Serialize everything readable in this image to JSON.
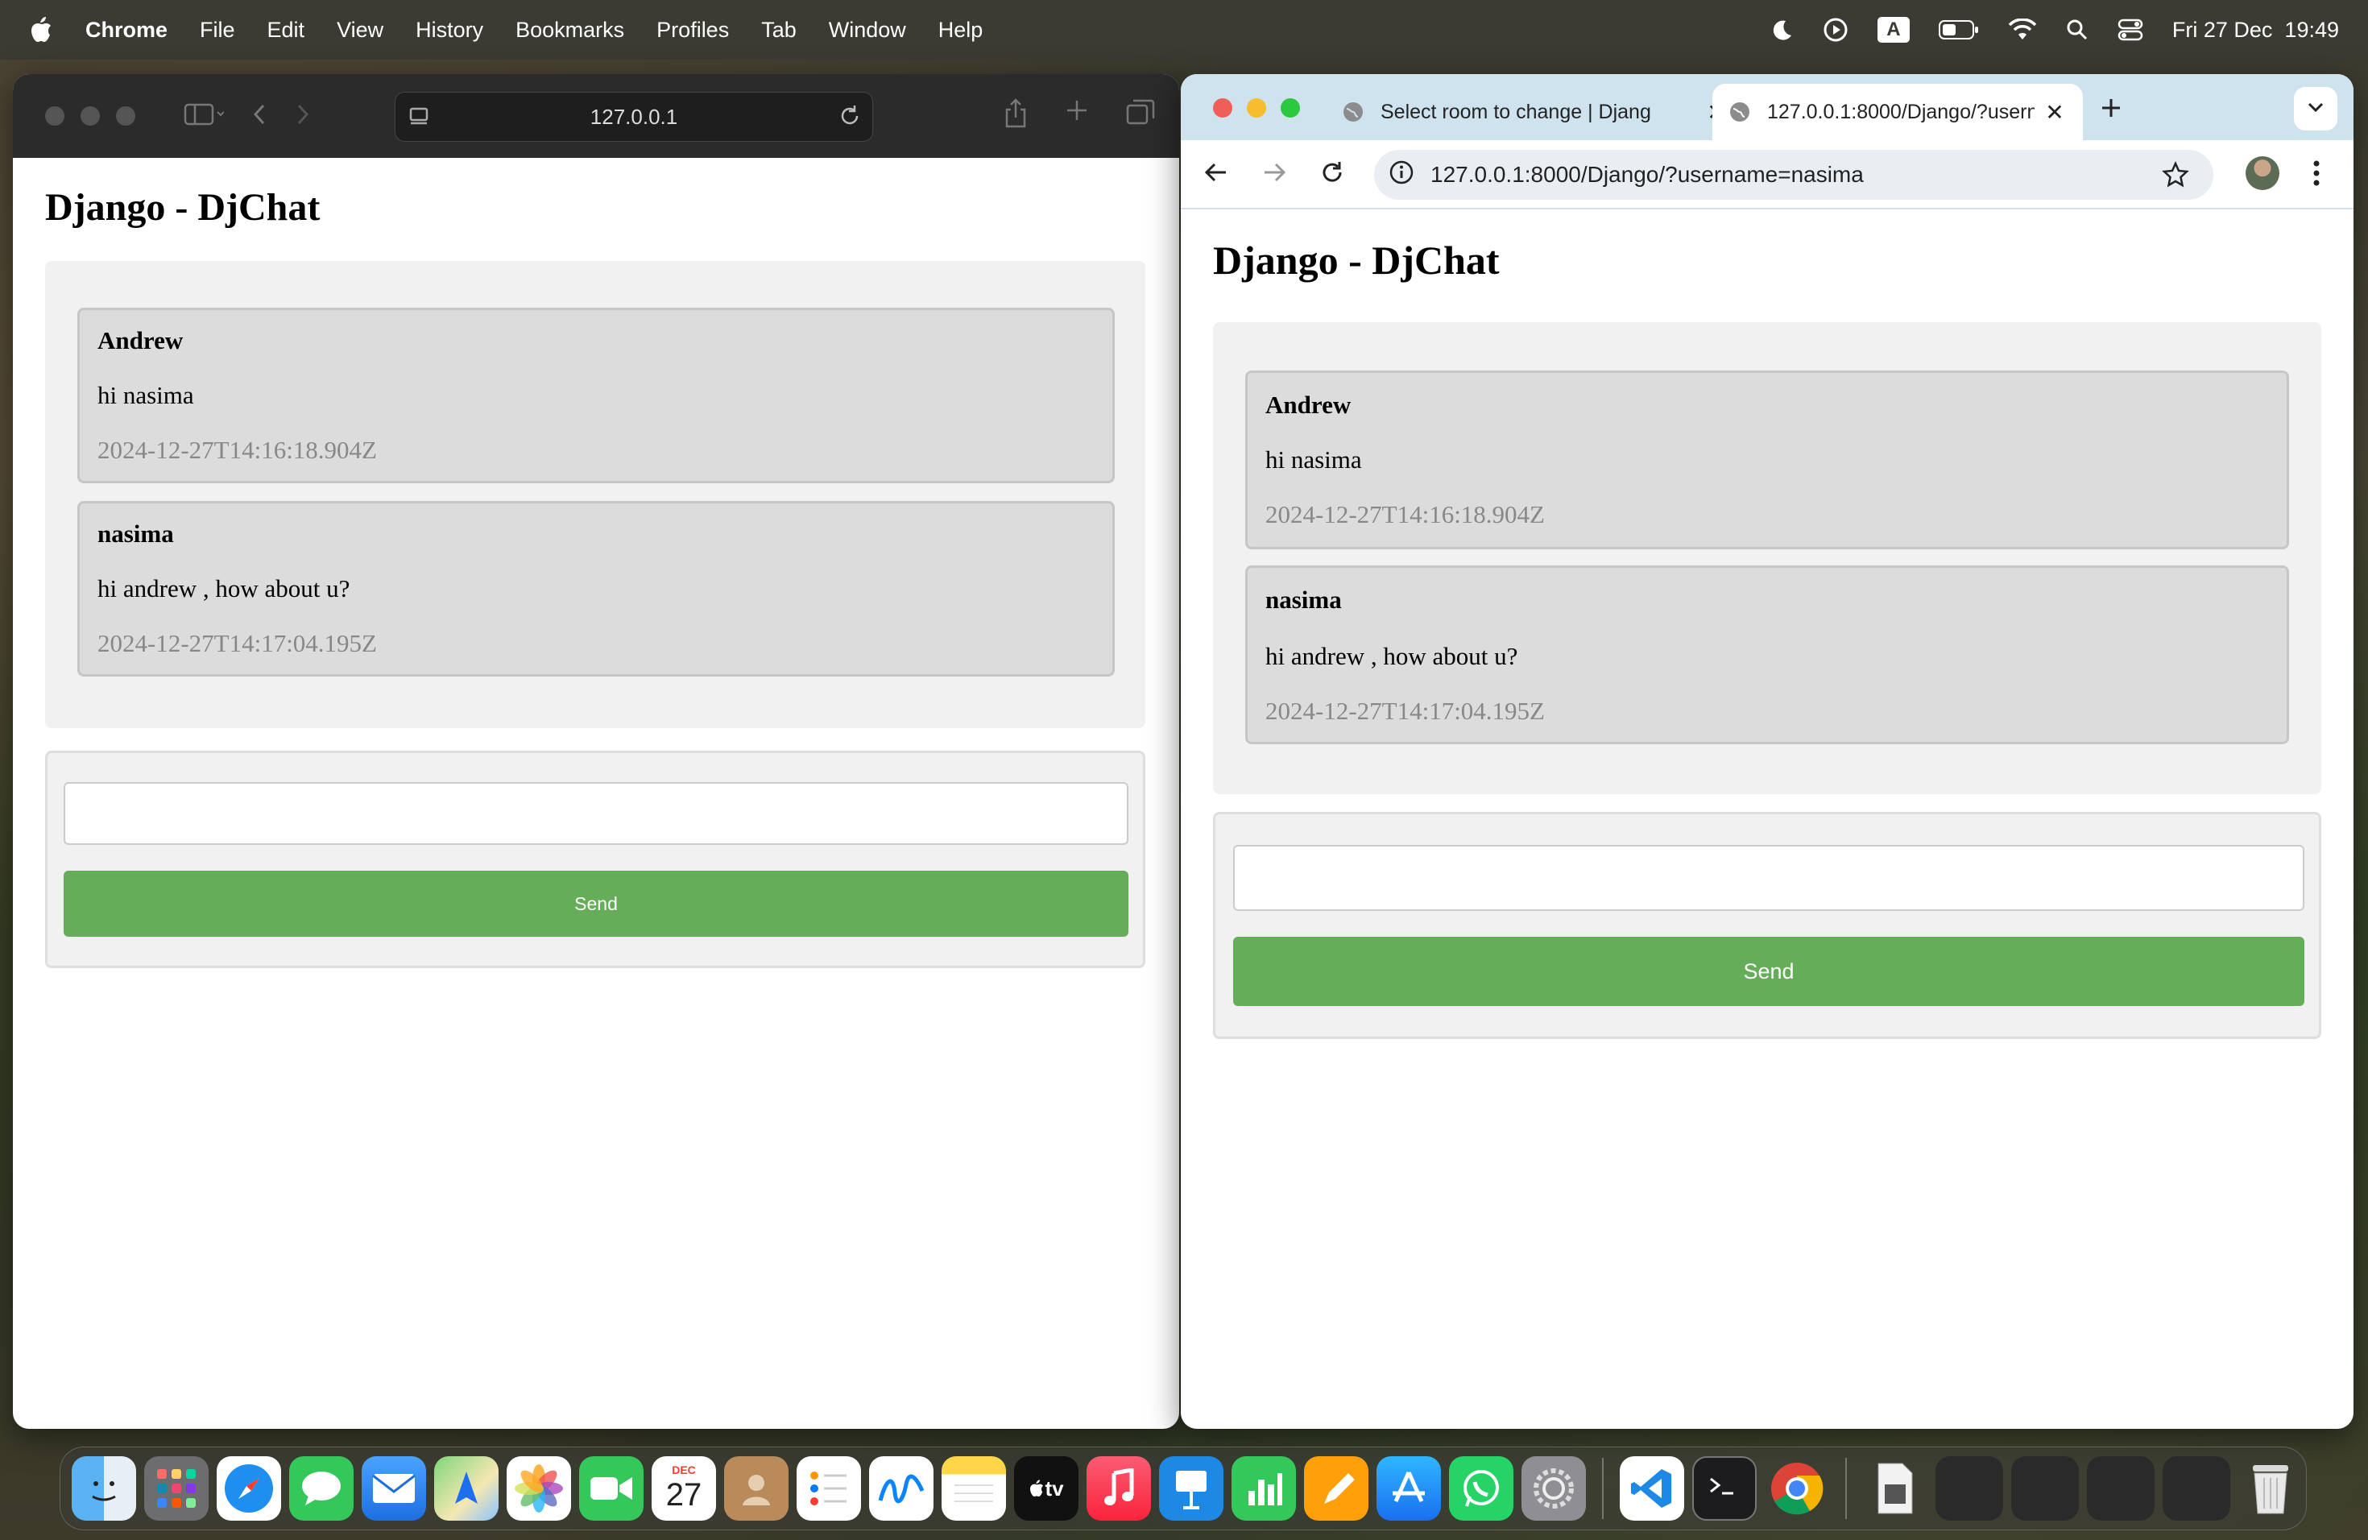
{
  "menubar": {
    "app": "Chrome",
    "items": [
      "File",
      "Edit",
      "View",
      "History",
      "Bookmarks",
      "Profiles",
      "Tab",
      "Window",
      "Help"
    ],
    "input_indicator": "A",
    "datetime": "Fri 27 Dec  19:49"
  },
  "safari": {
    "address": "127.0.0.1"
  },
  "chrome": {
    "tabs": [
      {
        "title": "Select room to change | Djang",
        "active": false
      },
      {
        "title": "127.0.0.1:8000/Django/?usern",
        "active": true
      }
    ],
    "address": "127.0.0.1:8000/Django/?username=nasima"
  },
  "page": {
    "title": "Django - DjChat",
    "messages": [
      {
        "author": "Andrew",
        "text": "hi nasima",
        "time": "2024-12-27T14:16:18.904Z"
      },
      {
        "author": "nasima",
        "text": "hi andrew , how about u?",
        "time": "2024-12-27T14:17:04.195Z"
      }
    ],
    "input_value": "",
    "send_label": "Send"
  },
  "dock": {
    "calendar_month": "DEC",
    "calendar_day": "27",
    "tv_label": "tv",
    "apps": [
      "finder",
      "launchpad",
      "safari",
      "messages",
      "mail",
      "maps",
      "photos",
      "facetime",
      "calendar",
      "contacts",
      "reminders",
      "freeform",
      "notes",
      "appletv",
      "music",
      "keynote",
      "numbers",
      "pages",
      "appstore",
      "whatsapp",
      "system-settings",
      "vscode",
      "terminal",
      "chrome",
      "file",
      "window-1",
      "window-2",
      "window-3",
      "window-4",
      "trash"
    ]
  }
}
